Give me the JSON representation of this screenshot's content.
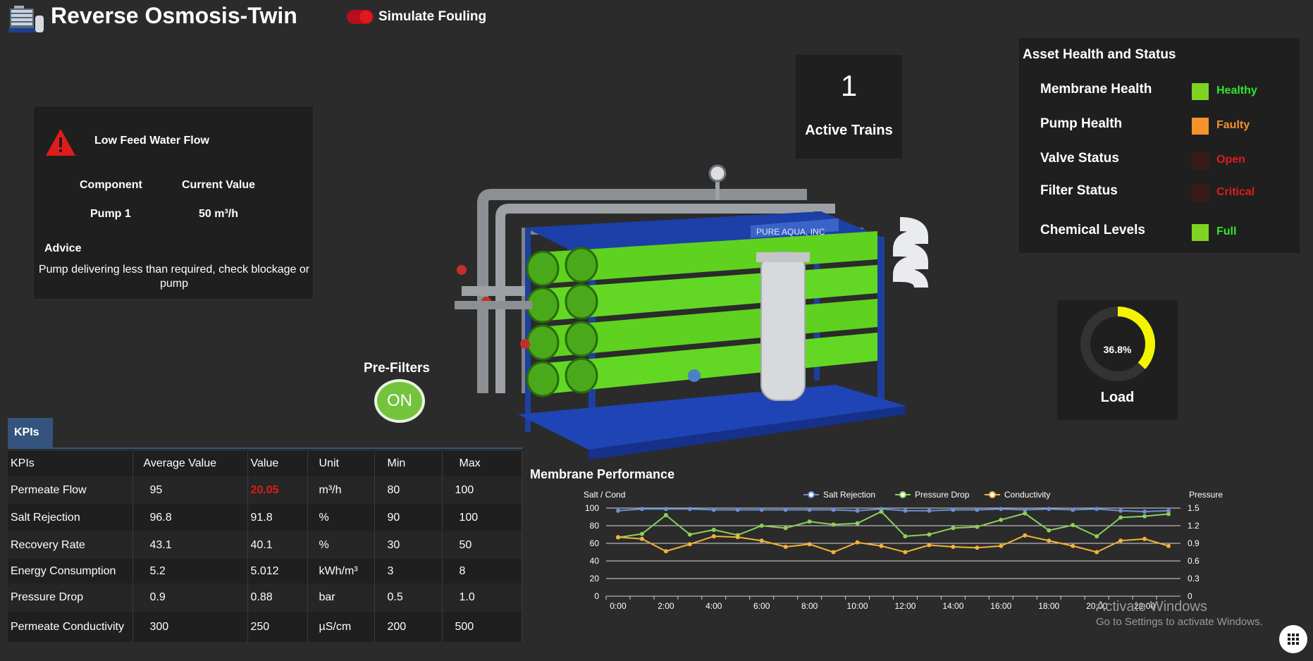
{
  "header": {
    "title": "Reverse Osmosis-Twin",
    "fouling_label": "Simulate Fouling"
  },
  "alert": {
    "title": "Low Feed Water Flow",
    "component_header": "Component",
    "current_value_header": "Current Value",
    "component": "Pump 1",
    "current_value": "50  m³/h",
    "advice_header": "Advice",
    "advice": "Pump delivering less than required, check blockage or pump"
  },
  "trains": {
    "count": "1",
    "label": "Active Trains"
  },
  "health": {
    "title": "Asset Health and Status",
    "items": [
      {
        "label": "Membrane Health",
        "status": "Healthy",
        "swatch": "#7ed321",
        "color": "#2ee62e"
      },
      {
        "label": "Pump Health",
        "status": "Faulty",
        "swatch": "#f5922b",
        "color": "#f5922b"
      },
      {
        "label": "Valve Status",
        "status": "Open",
        "swatch": "#3a1a1a",
        "color": "#e01b1b"
      },
      {
        "label": "Filter Status",
        "status": "Critical",
        "swatch": "#3a1a1a",
        "color": "#e01b1b"
      },
      {
        "label": "Chemical Levels",
        "status": "Full",
        "swatch": "#7ed321",
        "color": "#2ee62e"
      }
    ]
  },
  "load": {
    "value": "36.8%",
    "fraction": 0.368,
    "label": "Load",
    "color": "#f5f500"
  },
  "prefilters": {
    "label": "Pre-Filters",
    "state": "ON"
  },
  "machine": {
    "brand": "PURE AQUA, INC"
  },
  "kpis": {
    "tab": "KPIs",
    "headers": [
      "KPIs",
      "Average Value",
      "Value",
      "Unit",
      "Min",
      "Max"
    ],
    "rows": [
      [
        "Permeate Flow",
        "95",
        "20.05",
        "m³/h",
        "80",
        "100"
      ],
      [
        "Salt Rejection",
        "96.8",
        "91.8",
        "%",
        "90",
        "100"
      ],
      [
        "Recovery Rate",
        "43.1",
        "40.1",
        "%",
        "30",
        "50"
      ],
      [
        "Energy Consumption",
        "5.2",
        "5.012",
        "kWh/m³",
        "3",
        "8"
      ],
      [
        "Pressure Drop",
        "0.9",
        "0.88",
        "bar",
        "0.5",
        "1.0"
      ],
      [
        "Permeate Conductivity",
        "300",
        "250",
        "µS/cm",
        "200",
        "500"
      ]
    ],
    "alert_color": "#e01b1b"
  },
  "chart_data": {
    "type": "line",
    "title": "Membrane Performance",
    "ylabel": "Salt / Cond",
    "y2label": "Pressure",
    "ylim": [
      0,
      100
    ],
    "y2lim": [
      0,
      1.5
    ],
    "yticks": [
      "0",
      "20",
      "40",
      "60",
      "80",
      "100"
    ],
    "y2ticks": [
      "0",
      "0.3",
      "0.6",
      "0.9",
      "1.2",
      "1.5"
    ],
    "x": [
      "0:00",
      "1:00",
      "2:00",
      "3:00",
      "4:00",
      "5:00",
      "6:00",
      "7:00",
      "8:00",
      "9:00",
      "10:00",
      "11:00",
      "12:00",
      "13:00",
      "14:00",
      "15:00",
      "16:00",
      "17:00",
      "18:00",
      "19:00",
      "20:00",
      "21:00",
      "22:00",
      "23:00"
    ],
    "xtick_labels": [
      "0:00",
      "",
      "2:00",
      "",
      "4:00",
      "",
      "6:00",
      "",
      "8:00",
      "",
      "10:00",
      "",
      "12:00",
      "",
      "14:00",
      "",
      "16:00",
      "",
      "18:00",
      "",
      "20:00",
      "",
      "22:00",
      ""
    ],
    "legend_position": "top-center",
    "grid": true,
    "series": [
      {
        "name": "Salt Rejection",
        "axis": "left",
        "color": "#6b8fd6",
        "values": [
          97,
          99,
          99,
          99,
          98,
          98,
          98,
          98,
          98,
          98,
          97,
          99,
          97,
          97,
          98,
          98,
          99,
          98,
          99,
          98,
          99,
          97,
          96,
          97
        ]
      },
      {
        "name": "Pressure Drop",
        "axis": "right",
        "color": "#8ccf5a",
        "values": [
          1.0,
          1.06,
          1.38,
          1.05,
          1.13,
          1.04,
          1.2,
          1.16,
          1.27,
          1.22,
          1.24,
          1.44,
          1.02,
          1.05,
          1.16,
          1.18,
          1.3,
          1.41,
          1.12,
          1.21,
          1.02,
          1.34,
          1.36,
          1.4
        ]
      },
      {
        "name": "Conductivity",
        "axis": "left",
        "color": "#f3b23a",
        "values": [
          67,
          65,
          51,
          59,
          68,
          67,
          63,
          56,
          59,
          50,
          61,
          57,
          50,
          58,
          56,
          55,
          57,
          69,
          63,
          57,
          50,
          63,
          65,
          57
        ]
      }
    ]
  },
  "watermark": {
    "line1": "Activate Windows",
    "line2": "Go to Settings to activate Windows."
  }
}
